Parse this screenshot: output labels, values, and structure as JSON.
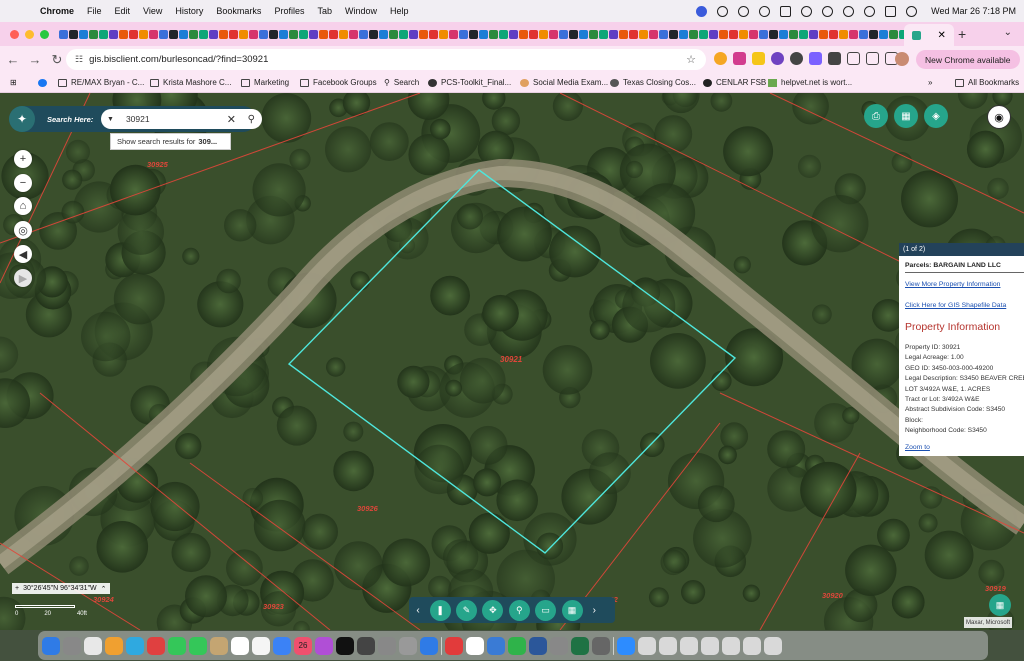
{
  "menubar": {
    "app": "Chrome",
    "items": [
      "File",
      "Edit",
      "View",
      "History",
      "Bookmarks",
      "Profiles",
      "Tab",
      "Window",
      "Help"
    ],
    "clock": "Wed Mar 26  7:18 PM"
  },
  "browser": {
    "url": "gis.bisclient.com/burlesoncad/?find=30921",
    "new_chrome": "New Chrome available",
    "bookmarks": [
      "RE/MAX Bryan - C...",
      "Krista Mashore C...",
      "Marketing",
      "Facebook Groups",
      "Search",
      "PCS-Toolkit_Final...",
      "Social Media Exam...",
      "Texas Closing Cos...",
      "CENLAR FSB",
      "helpvet.net is wort..."
    ],
    "more_bookmarks": "»",
    "all_bookmarks": "All Bookmarks"
  },
  "map": {
    "search_label": "Search Here:",
    "search_value": "30921",
    "suggest_prefix": "Show search results for",
    "suggest_value": "309...",
    "parcel_id_label": "30921",
    "neighbor_labels": [
      "30925",
      "30926",
      "30923",
      "30924",
      "30922",
      "30920",
      "30919"
    ],
    "coordinate": "30°26'45\"N 96°34'31\"W",
    "scale_ticks": [
      "0",
      "20",
      "40ft"
    ],
    "attribution": "Maxar, Microsoft"
  },
  "popup": {
    "pager": "(1 of 2)",
    "parcels": "Parcels: BARGAIN LAND LLC",
    "link_more": "View More Property Information",
    "link_shapefile": "Click Here for GIS Shapefile Data",
    "title": "Property Information",
    "rows": [
      "Property ID: 30921",
      "Legal Acreage: 1.00",
      "GEO ID: 3450-003-000-49200",
      "Legal Description: S3450 BEAVER CREEK SUBDIVISION",
      "LOT 3/492A W&E, 1. ACRES",
      "Tract or Lot: 3/492A W&E",
      "Abstract Subdivision Code: S3450",
      "Block:",
      "Neighborhood Code: S3450"
    ],
    "zoom": "Zoom to"
  },
  "dock": {
    "calendar_day": "26"
  },
  "colors": {
    "accent_teal": "#26a58b",
    "panel_navy": "#1f4b5c",
    "parcel_outline": "#4ee6dc",
    "parcel_line": "#e0463a",
    "tabstrip_pink": "#f7d1eb"
  }
}
